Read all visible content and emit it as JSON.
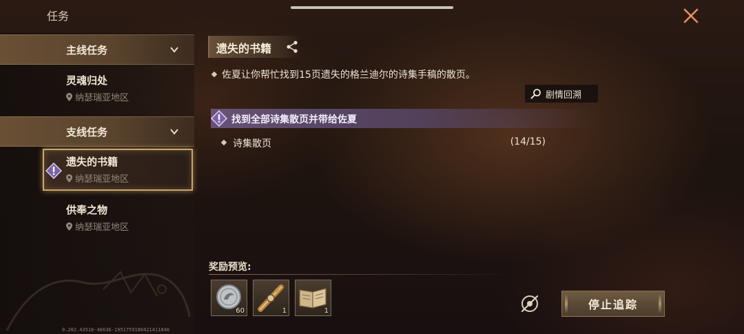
{
  "screen": {
    "title": "任务"
  },
  "sidebar": {
    "categories": [
      {
        "label": "主线任务"
      },
      {
        "label": "支线任务"
      }
    ],
    "quests": [
      {
        "title": "灵魂归处",
        "region": "纳瑟瑞亚地区"
      },
      {
        "title": "遗失的书籍",
        "region": "纳瑟瑞亚地区",
        "selected": true
      },
      {
        "title": "供奉之物",
        "region": "纳瑟瑞亚地区"
      }
    ],
    "version": "0.202.43516-46636-1951759180421411840"
  },
  "detail": {
    "title": "遗失的书籍",
    "description": "佐夏让你帮忙找到15页遗失的格兰迪尔的诗集手稿的散页。",
    "recall_label": "剧情回溯",
    "objective": "找到全部诗集散页并带给佐夏",
    "sub_objectives": [
      {
        "label": "诗集散页",
        "progress": "(14/15)"
      }
    ]
  },
  "rewards": {
    "title": "奖励预览:",
    "items": [
      {
        "icon": "silver-coin-icon",
        "count": "60"
      },
      {
        "icon": "ornate-scroll-icon",
        "count": "1"
      },
      {
        "icon": "open-book-icon",
        "count": "1"
      }
    ]
  },
  "actions": {
    "stop_tracking_label": "停止追踪"
  },
  "colors": {
    "accent_gold": "#c9a66b",
    "objective_purple": "#7a6699"
  }
}
